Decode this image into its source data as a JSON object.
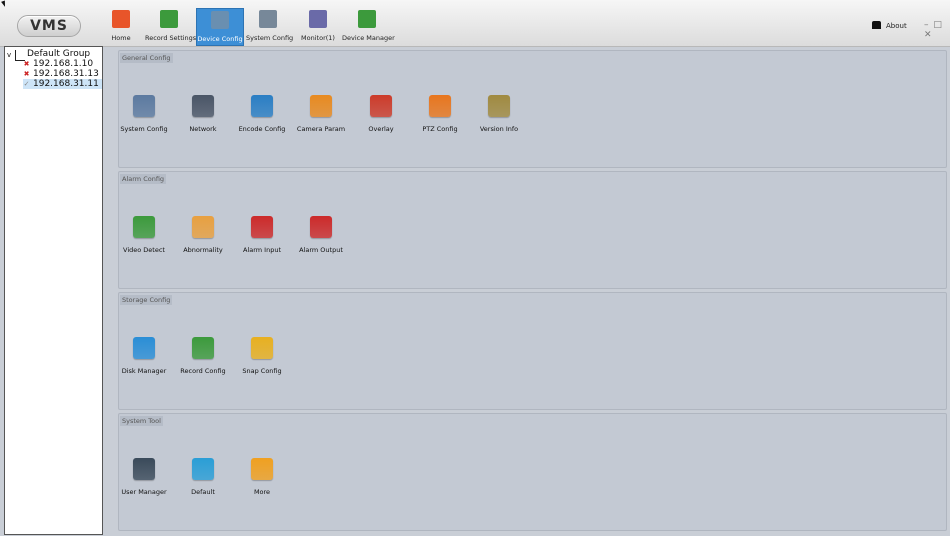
{
  "app": {
    "logo_text": "VMS"
  },
  "toolbar": {
    "tabs": [
      {
        "label": "Home",
        "icon": "home-icon",
        "color": "#e8552a"
      },
      {
        "label": "Record Settings",
        "icon": "record-settings-icon",
        "color": "#3c9a3c"
      },
      {
        "label": "Device Config",
        "icon": "device-config-icon",
        "color": "#6a8fb0",
        "active": true
      },
      {
        "label": "System Config",
        "icon": "system-config-icon",
        "color": "#778899"
      },
      {
        "label": "Monitor(1)",
        "icon": "monitor-icon",
        "color": "#6a6aa8"
      },
      {
        "label": "Device Manager",
        "icon": "device-manager-icon",
        "color": "#3c9a3c"
      }
    ],
    "about_label": "About",
    "window_controls": "– □ ✕"
  },
  "device_tree": {
    "group_label": "Default Group",
    "toggle": "v",
    "devices": [
      {
        "label": "192.168.1.10",
        "mark": "✖",
        "mark_color": "#cc2222"
      },
      {
        "label": "192.168.31.13",
        "mark": "✖",
        "mark_color": "#cc2222"
      },
      {
        "label": "192.168.31.11",
        "mark": "✓",
        "mark_color": "#888888",
        "selected": true
      }
    ]
  },
  "sections": [
    {
      "title": "General Config",
      "items": [
        {
          "label": "System Config",
          "icon": "gear-icon",
          "color": "#5c7aa0"
        },
        {
          "label": "Network",
          "icon": "network-icon",
          "color": "#4a5566"
        },
        {
          "label": "Encode Config",
          "icon": "encode-icon",
          "color": "#2a7ec4"
        },
        {
          "label": "Camera Param",
          "icon": "camera-icon",
          "color": "#e88a20"
        },
        {
          "label": "Overlay",
          "icon": "overlay-icon",
          "color": "#cc3b2a"
        },
        {
          "label": "PTZ Config",
          "icon": "ptz-icon",
          "color": "#e8761e"
        },
        {
          "label": "Version Info",
          "icon": "version-icon",
          "color": "#a08a40"
        }
      ]
    },
    {
      "title": "Alarm Config",
      "items": [
        {
          "label": "Video Detect",
          "icon": "video-detect-icon",
          "color": "#3c9a3c"
        },
        {
          "label": "Abnormality",
          "icon": "abnormality-icon",
          "color": "#e8a040"
        },
        {
          "label": "Alarm Input",
          "icon": "alarm-input-icon",
          "color": "#cc2a2a"
        },
        {
          "label": "Alarm Output",
          "icon": "alarm-output-icon",
          "color": "#cc2a2a"
        }
      ]
    },
    {
      "title": "Storage Config",
      "items": [
        {
          "label": "Disk Manager",
          "icon": "disk-icon",
          "color": "#2a8ed6"
        },
        {
          "label": "Record Config",
          "icon": "record-config-icon",
          "color": "#3c9a3c"
        },
        {
          "label": "Snap Config",
          "icon": "snap-icon",
          "color": "#e8b020"
        }
      ]
    },
    {
      "title": "System Tool",
      "items": [
        {
          "label": "User Manager",
          "icon": "user-manager-icon",
          "color": "#3a4a5a"
        },
        {
          "label": "Default",
          "icon": "default-icon",
          "color": "#2a9ed6"
        },
        {
          "label": "More",
          "icon": "star-icon",
          "color": "#f0a020"
        }
      ]
    }
  ]
}
